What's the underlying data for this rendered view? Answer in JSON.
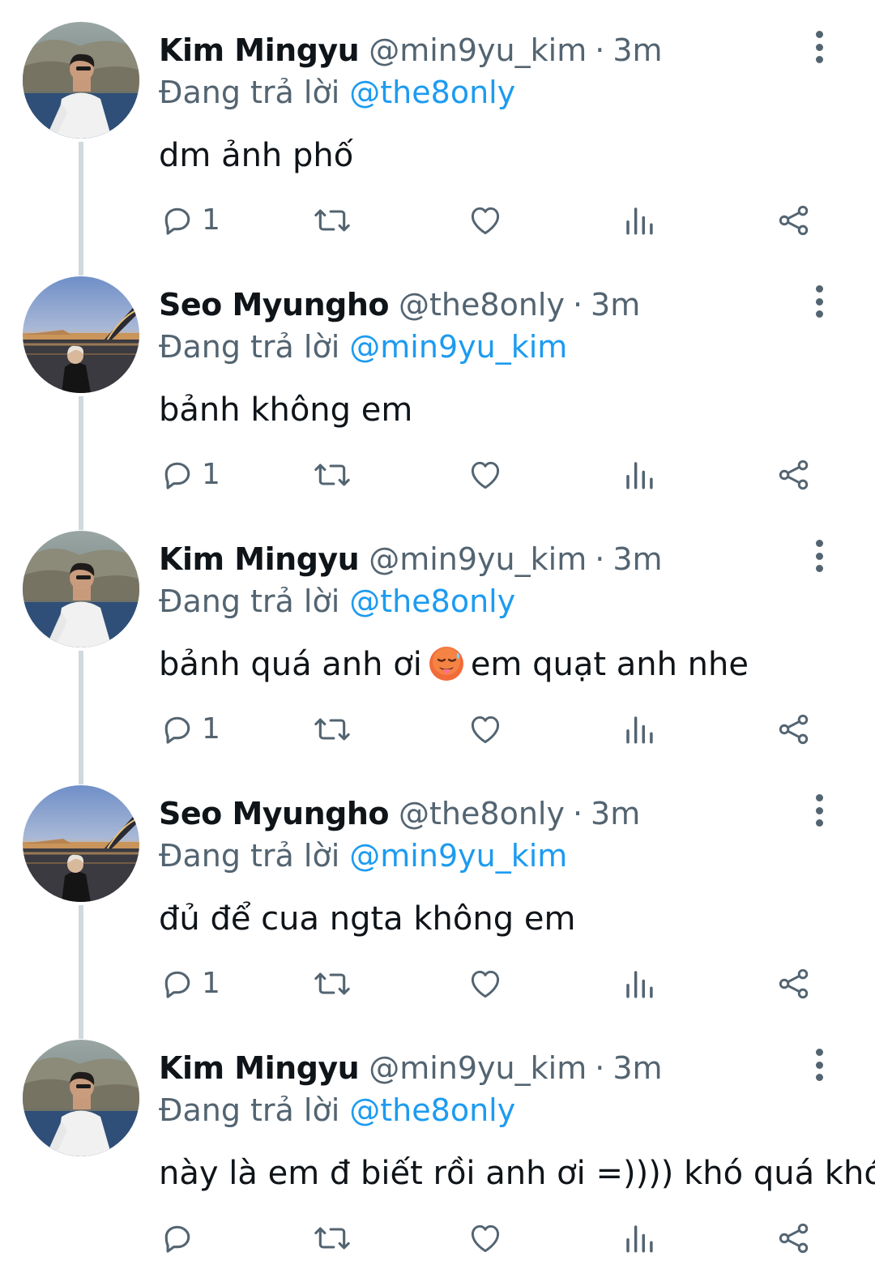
{
  "tweets": [
    {
      "name": "Kim Mingyu",
      "handle": "@min9yu_kim",
      "separator": "·",
      "time": "3m",
      "reply_prefix": "Đang trả lời",
      "reply_to": "@the8only",
      "text_before": "dm ảnh phố",
      "emoji": "",
      "text_after": "",
      "reply_count": "1",
      "avatar": "kim-mingyu"
    },
    {
      "name": "Seo Myungho",
      "handle": "@the8only",
      "separator": "·",
      "time": "3m",
      "reply_prefix": "Đang trả lời",
      "reply_to": "@min9yu_kim",
      "text_before": "bảnh không em",
      "emoji": "",
      "text_after": "",
      "reply_count": "1",
      "avatar": "seo-myungho"
    },
    {
      "name": "Kim Mingyu",
      "handle": "@min9yu_kim",
      "separator": "·",
      "time": "3m",
      "reply_prefix": "Đang trả lời",
      "reply_to": "@the8only",
      "text_before": "bảnh quá anh ơi",
      "emoji": "hot-face-emoji",
      "text_after": "em quạt anh nhe",
      "reply_count": "1",
      "avatar": "kim-mingyu"
    },
    {
      "name": "Seo Myungho",
      "handle": "@the8only",
      "separator": "·",
      "time": "3m",
      "reply_prefix": "Đang trả lời",
      "reply_to": "@min9yu_kim",
      "text_before": "đủ để cua ngta không em",
      "emoji": "",
      "text_after": "",
      "reply_count": "1",
      "avatar": "seo-myungho"
    },
    {
      "name": "Kim Mingyu",
      "handle": "@min9yu_kim",
      "separator": "·",
      "time": "3m",
      "reply_prefix": "Đang trả lời",
      "reply_to": "@the8only",
      "text_before": "này là em đ biết rồi anh ơi =)))) khó quá khó",
      "emoji": "",
      "text_after": "",
      "reply_count": "",
      "avatar": "kim-mingyu"
    }
  ],
  "icons": {
    "more": "more-vertical-icon",
    "reply": "reply-bubble-icon",
    "retweet": "retweet-icon",
    "like": "heart-icon",
    "stats": "analytics-icon",
    "share": "share-icon"
  },
  "colors": {
    "name": "#0f1419",
    "secondary": "#536471",
    "link": "#1d9bf0",
    "thread_line": "#cfd9de"
  }
}
